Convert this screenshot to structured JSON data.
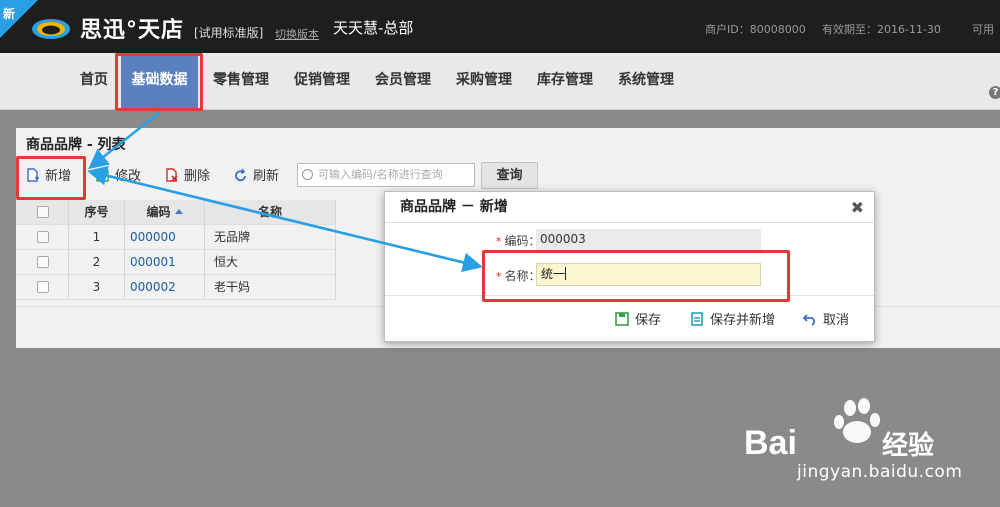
{
  "header": {
    "corner_badge": "新",
    "brand": "思迅°天店",
    "edition": "[试用标准版]",
    "switch_version": "切换版本",
    "store_name": "天天慧-总部",
    "merchant_id": "商户ID：80008000",
    "expire": "有效期至：2016-11-30",
    "available": "可用"
  },
  "nav": {
    "items": [
      {
        "label": "首页"
      },
      {
        "label": "基础数据"
      },
      {
        "label": "零售管理"
      },
      {
        "label": "促销管理"
      },
      {
        "label": "会员管理"
      },
      {
        "label": "采购管理"
      },
      {
        "label": "库存管理"
      },
      {
        "label": "系统管理"
      }
    ],
    "active_index": 1,
    "help": "?"
  },
  "panel": {
    "title": "商品品牌 - 列表",
    "toolbar": {
      "add": "新增",
      "edit": "修改",
      "delete": "删除",
      "refresh": "刷新",
      "search_placeholder": "可输入编码/名称进行查询",
      "query": "查询"
    },
    "table": {
      "columns": [
        "序号",
        "编码",
        "名称"
      ],
      "rows": [
        {
          "seq": "1",
          "code": "000000",
          "name": "无品牌"
        },
        {
          "seq": "2",
          "code": "000001",
          "name": "恒大"
        },
        {
          "seq": "3",
          "code": "000002",
          "name": "老干妈"
        }
      ]
    }
  },
  "dialog": {
    "title": "商品品牌 － 新增",
    "code_label": "编码：",
    "code_value": "000003",
    "name_label": "名称：",
    "name_value": "统一",
    "required_mark": "*",
    "save": "保存",
    "save_and_new": "保存并新增",
    "cancel": "取消"
  },
  "watermark": {
    "logo_text": "Baidu经验",
    "url": "jingyan.baidu.com"
  },
  "colors": {
    "nav_active": "#5a80bf",
    "annotation_red": "#e53838",
    "annotation_arrow": "#2a9fe6",
    "link_blue": "#1a5fa8"
  }
}
